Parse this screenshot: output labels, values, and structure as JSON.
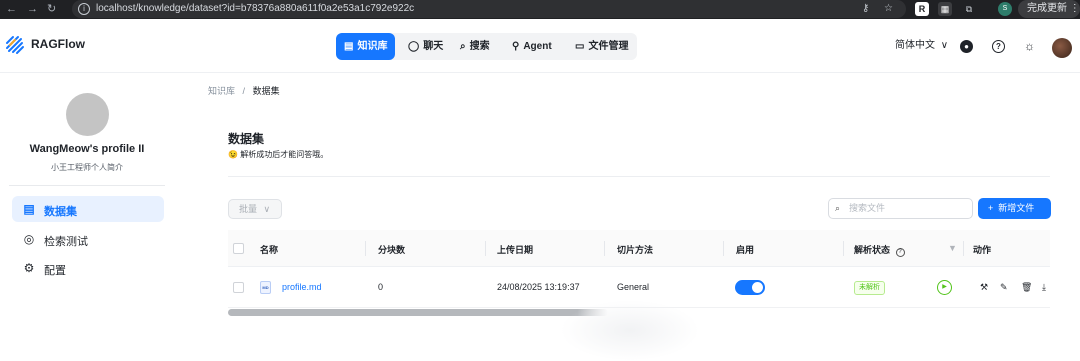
{
  "browser": {
    "url": "localhost/knowledge/dataset?id=b78376a880a611f0a2e53a1c792e922c",
    "update_label": "完成更新",
    "profile_initial": "S"
  },
  "header": {
    "brand": "RAGFlow",
    "nav": [
      {
        "label": "知识库",
        "icon": "database-icon",
        "active": true
      },
      {
        "label": "聊天",
        "icon": "chat-icon",
        "active": false
      },
      {
        "label": "搜索",
        "icon": "search-icon",
        "active": false
      },
      {
        "label": "Agent",
        "icon": "agent-icon",
        "active": false
      },
      {
        "label": "文件管理",
        "icon": "folder-icon",
        "active": false
      }
    ],
    "language": "简体中文",
    "accent": "#1677ff"
  },
  "sidebar": {
    "profile_name": "WangMeow's profile II",
    "profile_desc": "小王工程师个人简介",
    "items": [
      {
        "label": "数据集",
        "icon": "document-icon",
        "active": true
      },
      {
        "label": "检索测试",
        "icon": "target-icon",
        "active": false
      },
      {
        "label": "配置",
        "icon": "gear-icon",
        "active": false
      }
    ]
  },
  "main": {
    "breadcrumb": {
      "root": "知识库",
      "sep": "/",
      "current": "数据集"
    },
    "title": "数据集",
    "desc_emoji": "😉",
    "description": "解析成功后才能问答哦。",
    "bulk_label": "批量",
    "search_placeholder": "搜索文件",
    "add_label": "新增文件",
    "table": {
      "columns": [
        "名称",
        "分块数",
        "上传日期",
        "切片方法",
        "启用",
        "解析状态",
        "动作"
      ],
      "rows": [
        {
          "name": "profile.md",
          "file_type": "MD",
          "chunks": "0",
          "upload_date": "24/08/2025 13:19:37",
          "chunk_method": "General",
          "enabled": true,
          "parse_status": "未解析"
        }
      ]
    }
  }
}
